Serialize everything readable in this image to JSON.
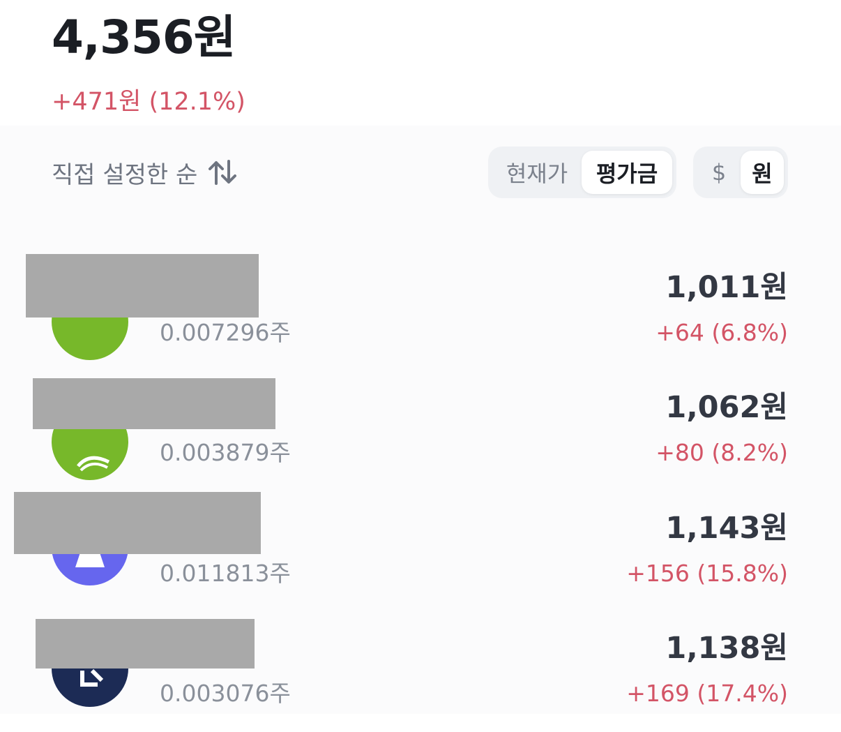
{
  "summary": {
    "total_value": "4,356원",
    "total_change": "+471원 (12.1%)"
  },
  "controls": {
    "sort_label": "직접 설정한 순",
    "price_type_options": [
      "현재가",
      "평가금"
    ],
    "price_type_selected": "평가금",
    "currency_options": [
      "$",
      "원"
    ],
    "currency_selected": "원"
  },
  "holdings": [
    {
      "shares": "0.007296주",
      "value": "1,011원",
      "change": "+64 (6.8%)",
      "logo_color": "#77b82a"
    },
    {
      "shares": "0.003879주",
      "value": "1,062원",
      "change": "+80 (8.2%)",
      "logo_color": "#77b82a"
    },
    {
      "shares": "0.011813주",
      "value": "1,143원",
      "change": "+156 (15.8%)",
      "logo_color": "#6666ee"
    },
    {
      "shares": "0.003076주",
      "value": "1,138원",
      "change": "+169 (17.4%)",
      "logo_color": "#1c2b55"
    }
  ],
  "colors": {
    "positive": "#d35466",
    "primary_text": "#1b1e24",
    "secondary_text": "#8a909a",
    "redaction": "#a9a9a9"
  }
}
